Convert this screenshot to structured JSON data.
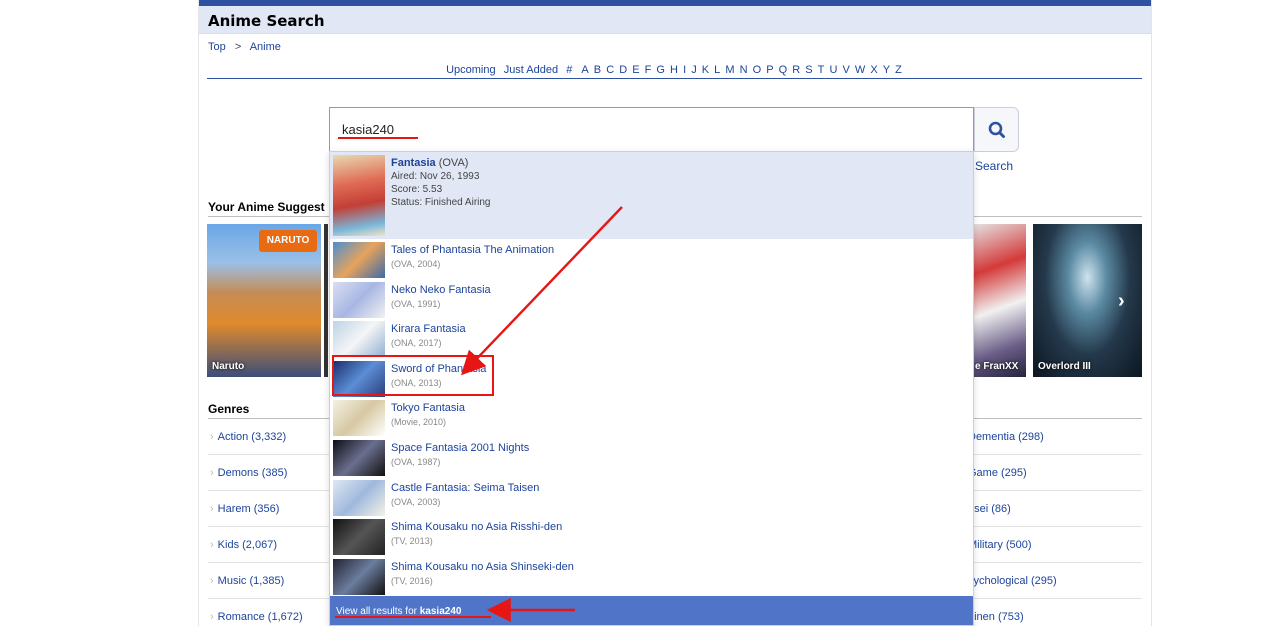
{
  "header": {
    "title": "Anime Search"
  },
  "breadcrumb": {
    "items": [
      "Top",
      ">",
      "Anime"
    ]
  },
  "alpha_nav": {
    "words": [
      "Upcoming",
      "Just Added",
      "#"
    ],
    "letters": [
      "A",
      "B",
      "C",
      "D",
      "E",
      "F",
      "G",
      "H",
      "I",
      "J",
      "K",
      "L",
      "M",
      "N",
      "O",
      "P",
      "Q",
      "R",
      "S",
      "T",
      "U",
      "V",
      "W",
      "X",
      "Y",
      "Z"
    ]
  },
  "search": {
    "value": "kasia240",
    "button_icon": "search-icon",
    "advanced_link": "d Search"
  },
  "suggestions": {
    "title": "Your Anime Suggest",
    "posters": [
      {
        "caption": "Naruto",
        "logo": "NARUTO"
      },
      {
        "caption": "e FranXX"
      },
      {
        "caption": "Overlord III"
      }
    ],
    "next_icon": "chevron-right-icon"
  },
  "genres": {
    "title": "Genres",
    "left": [
      "Action (3,332)",
      "Demons (385)",
      "Harem (356)",
      "Kids (2,067)",
      "Music (1,385)",
      "Romance (1,672)"
    ],
    "right": [
      "Dementia (298)",
      "Game (295)",
      "osei (86)",
      "Military (500)",
      "sychological (295)",
      "einen (753)"
    ]
  },
  "dropdown": {
    "featured": {
      "title": "Fantasia",
      "type": "(OVA)",
      "aired": "Aired: Nov 26, 1993",
      "score": "Score: 5.53",
      "status": "Status: Finished Airing"
    },
    "results": [
      {
        "title": "Tales of Phantasia The Animation",
        "meta": "(OVA, 2004)"
      },
      {
        "title": "Neko Neko Fantasia",
        "meta": "(OVA, 1991)"
      },
      {
        "title": "Kirara Fantasia",
        "meta": "(ONA, 2017)"
      },
      {
        "title": "Sword of Phantasia",
        "meta": "(ONA, 2013)"
      },
      {
        "title": "Tokyo Fantasia",
        "meta": "(Movie, 2010)"
      },
      {
        "title": "Space Fantasia 2001 Nights",
        "meta": "(OVA, 1987)"
      },
      {
        "title": "Castle Fantasia: Seima Taisen",
        "meta": "(OVA, 2003)"
      },
      {
        "title": "Shima Kousaku no Asia Risshi-den",
        "meta": "(TV, 2013)"
      },
      {
        "title": "Shima Kousaku no Asia Shinseki-den",
        "meta": "(TV, 2016)"
      }
    ],
    "view_all_prefix": "View all results for",
    "view_all_query": "kasia240"
  },
  "colors": {
    "brand": "#2e51a2",
    "header_bg": "#e1e7f5",
    "view_all_bg": "#4f74c8",
    "annotation": "#e81515"
  }
}
